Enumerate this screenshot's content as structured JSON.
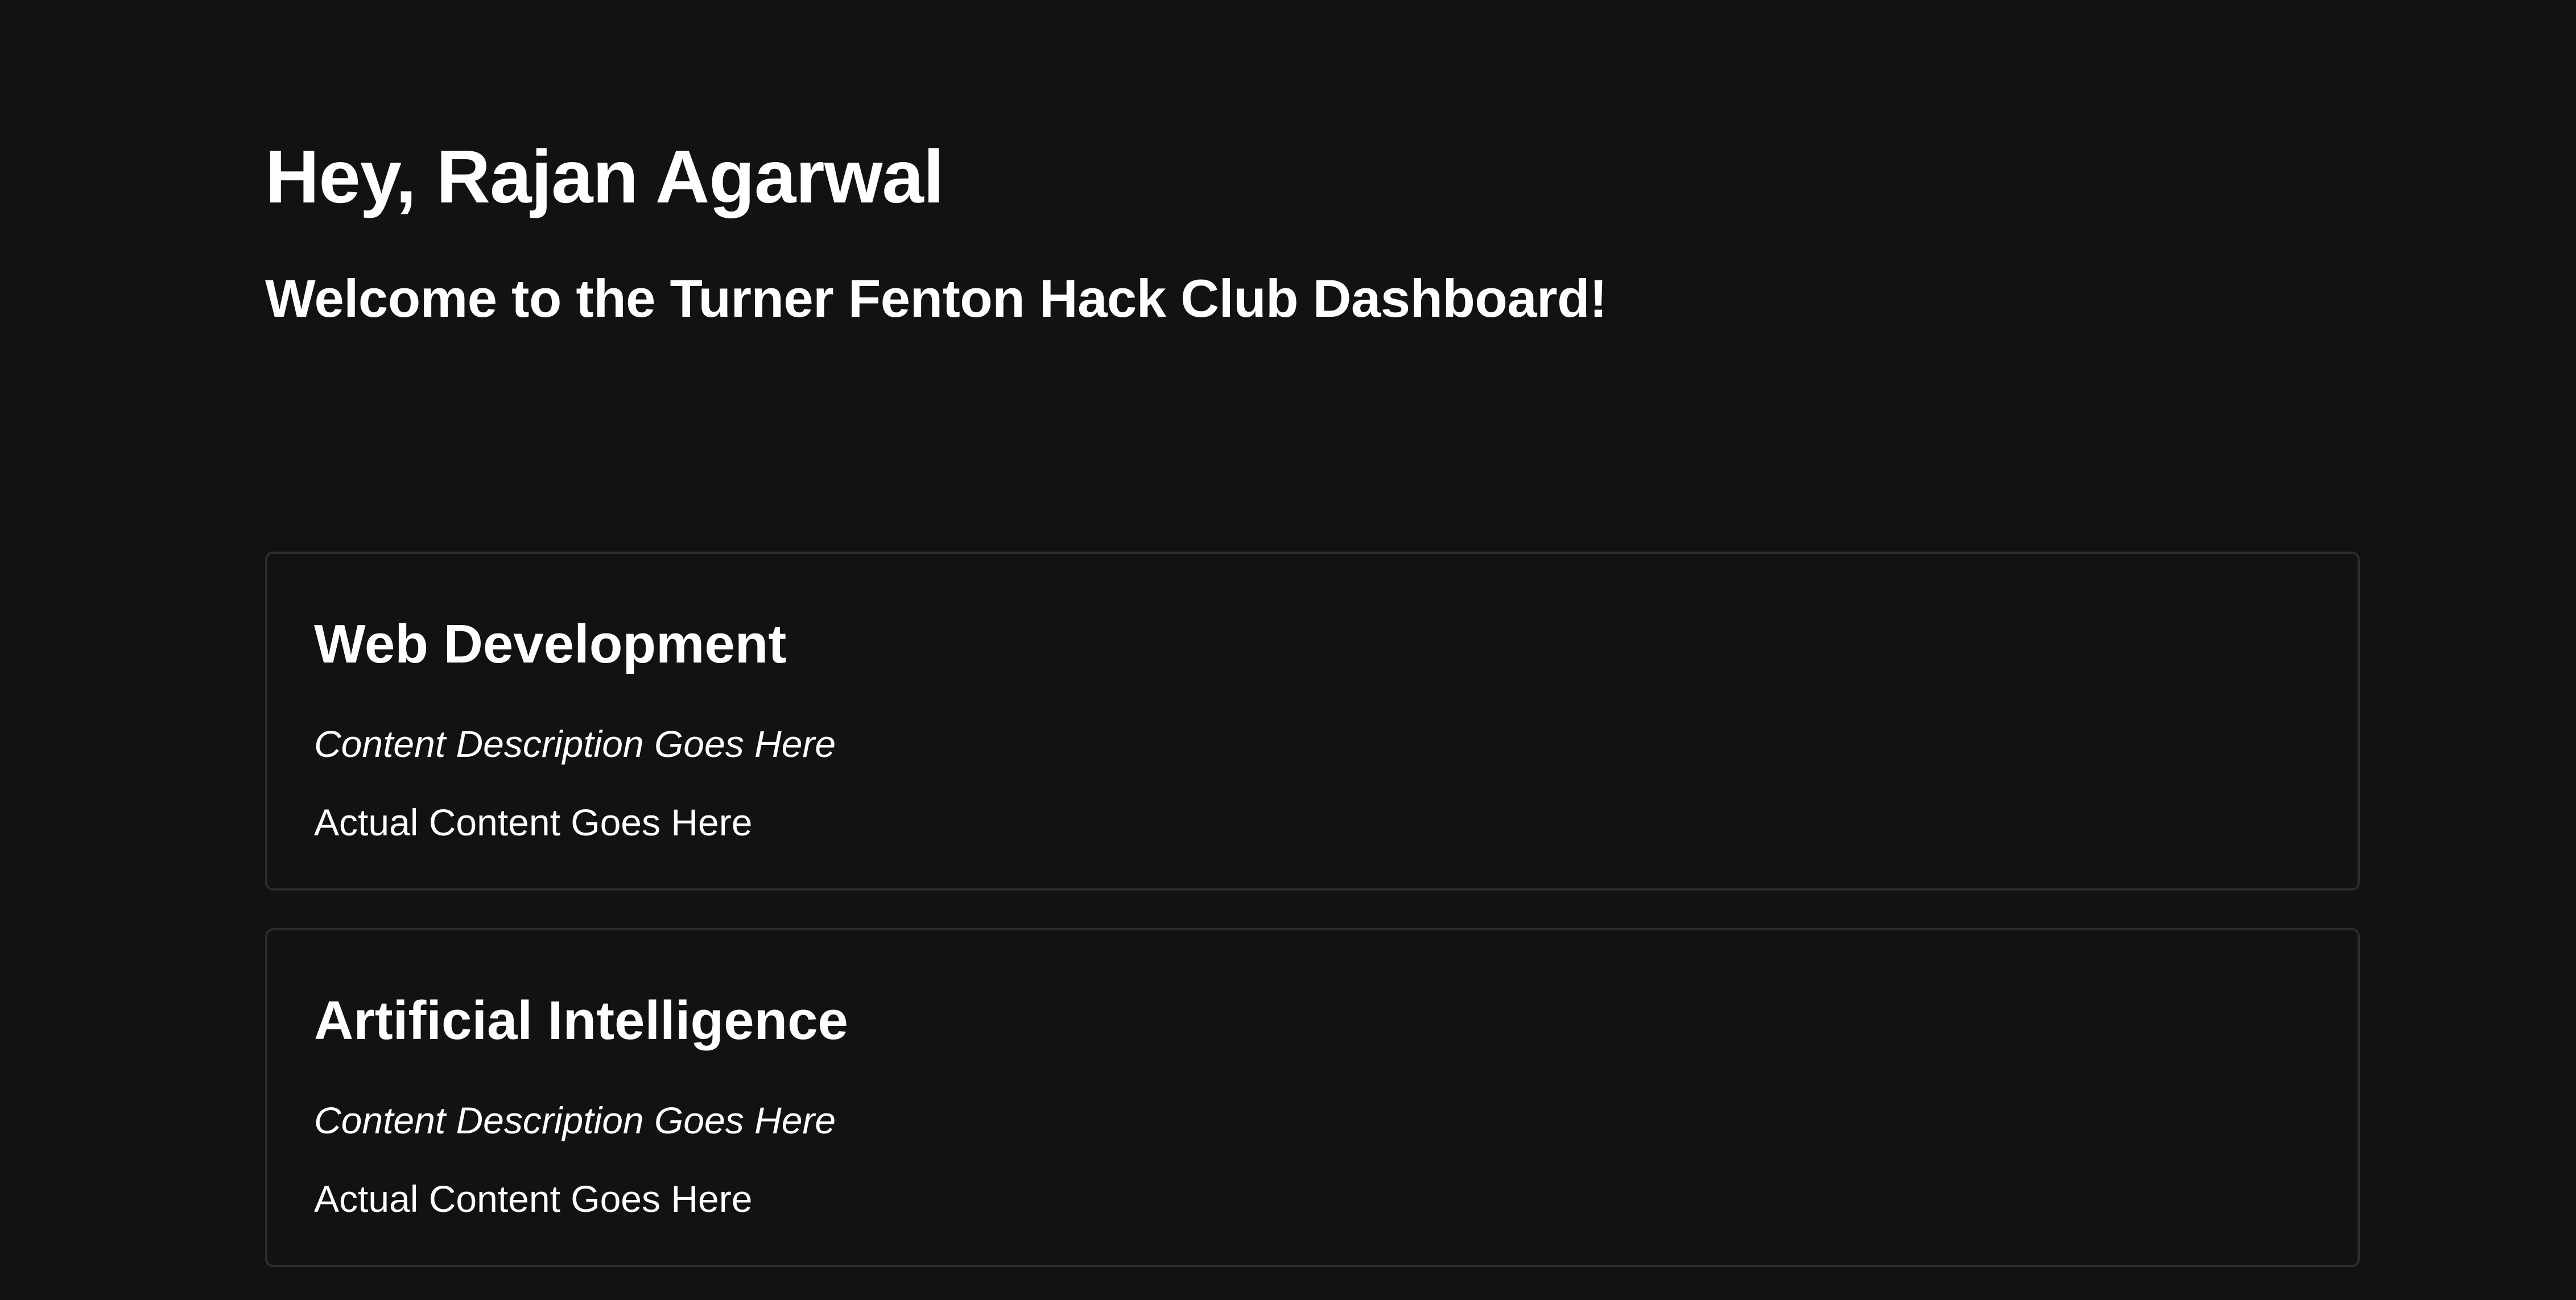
{
  "header": {
    "greeting": "Hey, Rajan Agarwal",
    "welcome": "Welcome to the Turner Fenton Hack Club Dashboard!"
  },
  "cards": [
    {
      "title": "Web Development",
      "description": "Content Description Goes Here",
      "content": "Actual Content Goes Here"
    },
    {
      "title": "Artificial Intelligence",
      "description": "Content Description Goes Here",
      "content": "Actual Content Goes Here"
    }
  ],
  "colors": {
    "background": "#121212",
    "text": "#ffffff",
    "card_border": "#2c2c2c"
  }
}
